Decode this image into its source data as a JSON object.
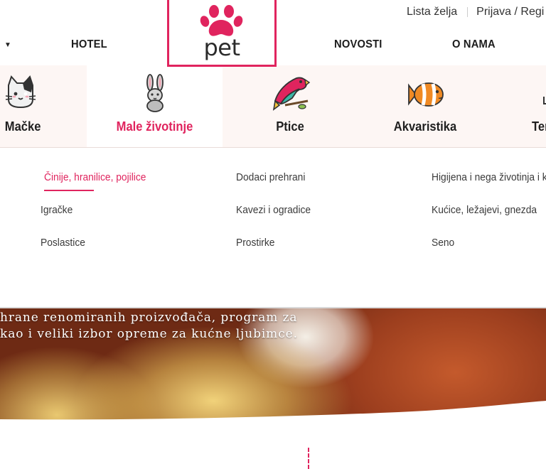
{
  "header": {
    "top_links": {
      "wishlist": "Lista želja",
      "login": "Prijava / Regi"
    },
    "nav": {
      "hotel": "HOTEL",
      "news": "NOVOSTI",
      "about": "O NAMA"
    },
    "logo_text": "pet",
    "brand_color": "#e0245e"
  },
  "categories": [
    {
      "label": "Mačke",
      "icon": "cat-icon"
    },
    {
      "label": "Male životinje",
      "icon": "rabbit-icon",
      "active": true
    },
    {
      "label": "Ptice",
      "icon": "parrot-icon"
    },
    {
      "label": "Akvaristika",
      "icon": "fish-icon"
    },
    {
      "label": "Ter",
      "icon": "terrarium-icon"
    }
  ],
  "submenu": {
    "col1": [
      "Činije, hranilice, pojilice",
      "Igračke",
      "Poslastice"
    ],
    "col2": [
      "Dodaci prehrani",
      "Kavezi i ogradice",
      "Prostirke"
    ],
    "col3": [
      "Higijena i nega životinja i ka",
      "Kućice, ležajevi, gnezda",
      "Seno"
    ]
  },
  "hero": {
    "line1": "hrane renomiranih proizvođača, program za",
    "line2": "kao i veliki izbor opreme za kućne ljubimce."
  }
}
